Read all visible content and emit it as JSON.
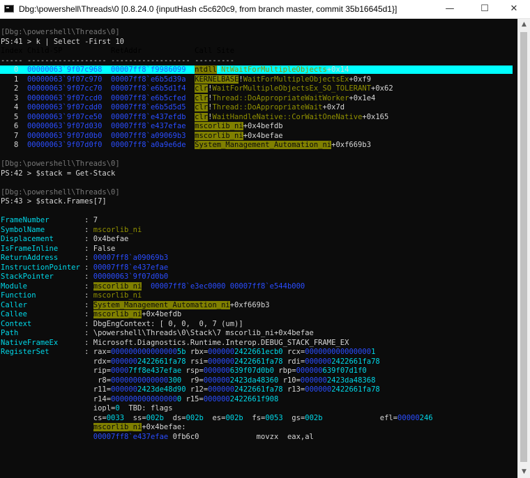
{
  "window": {
    "title": "Dbg:\\powershell\\Threads\\0 [0.8.24.0 {inputHash c5c620c9, from branch master, commit 35b16645d1}]",
    "minimize": "—",
    "maximize": "☐",
    "close": "✕"
  },
  "scrollbar": {
    "up": "▲",
    "down": "▼"
  },
  "console": {
    "prompt1_path": "[Dbg:\\powershell\\Threads\\0]",
    "prompt1_cmd": "PS:41 > k | Select -First 10",
    "hdr_index": "Index",
    "hdr_childsp": "Child-SP",
    "hdr_retaddr": "RetAddr",
    "hdr_callsite": "Call Site",
    "hdr_rule": "----- ------------------ ------------------ ---------",
    "frames": [
      {
        "idx": "0",
        "sp": "00000063`9f07c968",
        "ret": "00007ff8`f9986099",
        "mod": "ntdll",
        "sep": "!",
        "fn": "NtWaitForMultipleObjects",
        "off": "+0x14"
      },
      {
        "idx": "1",
        "sp": "00000063`9f07c970",
        "ret": "00007ff8`e6b5d39a",
        "mod": "KERNELBASE",
        "sep": "!",
        "fn": "WaitForMultipleObjectsEx",
        "off": "+0xf9"
      },
      {
        "idx": "2",
        "sp": "00000063`9f07cc70",
        "ret": "00007ff8`e6b5d1f4",
        "mod": "clr",
        "sep": "!",
        "fn": "WaitForMultipleObjectsEx_SO_TOLERANT",
        "off": "+0x62"
      },
      {
        "idx": "3",
        "sp": "00000063`9f07ccd0",
        "ret": "00007ff8`e6b5cfed",
        "mod": "clr",
        "sep": "!",
        "fn": "Thread::DoAppropriateWaitWorker",
        "off": "+0x1e4"
      },
      {
        "idx": "4",
        "sp": "00000063`9f07cdd0",
        "ret": "00007ff8`e6b5d5d5",
        "mod": "clr",
        "sep": "!",
        "fn": "Thread::DoAppropriateWait",
        "off": "+0x7d"
      },
      {
        "idx": "5",
        "sp": "00000063`9f07ce50",
        "ret": "00007ff8`e437efdb",
        "mod": "clr",
        "sep": "!",
        "fn": "WaitHandleNative::CorWaitOneNative",
        "off": "+0x165"
      },
      {
        "idx": "6",
        "sp": "00000063`9f07d030",
        "ret": "00007ff8`e437efae",
        "mod": "mscorlib_ni",
        "sep": "",
        "fn": "",
        "off": "+0x4befdb"
      },
      {
        "idx": "7",
        "sp": "00000063`9f07d0b0",
        "ret": "00007ff8`a09069b3",
        "mod": "mscorlib_ni",
        "sep": "",
        "fn": "",
        "off": "+0x4befae"
      },
      {
        "idx": "8",
        "sp": "00000063`9f07d0f0",
        "ret": "00007ff8`a0a9e6de",
        "mod": "System_Management_Automation_ni",
        "sep": "",
        "fn": "",
        "off": "+0xf669b3"
      }
    ],
    "prompt2_path": "[Dbg:\\powershell\\Threads\\0]",
    "prompt2_cmd": "PS:42 > $stack = Get-Stack",
    "prompt3_path": "[Dbg:\\powershell\\Threads\\0]",
    "prompt3_cmd": "PS:43 > $stack.Frames[7]",
    "props": {
      "FrameNumber": "7",
      "SymbolName": "mscorlib_ni",
      "Displacement": "0x4befae",
      "IsFrameInline": "False",
      "ReturnAddress": "00007ff8`a09069b3",
      "InstructionPointer": "00007ff8`e437efae",
      "StackPointer": "00000063`9f07d0b0",
      "Module_name": "mscorlib_ni",
      "Module_start": "00007ff8`e3ec0000",
      "Module_end": "00007ff8`e544b000",
      "Function": "mscorlib_ni",
      "Caller_mod": "System_Management_Automation_ni",
      "Caller_off": "+0xf669b3",
      "Callee_mod": "mscorlib_ni",
      "Callee_off": "+0x4befdb",
      "Context": "DbgEngContext: [ 0, 0,  0, 7 (um)]",
      "Path_text": "\\powershell\\Threads\\0\\Stack\\7 mscorlib_ni+0x4befae",
      "NativeFrameEx": "Microsoft.Diagnostics.Runtime.Interop.DEBUG_STACK_FRAME_EX"
    },
    "labels": {
      "FrameNumber": "FrameNumber",
      "SymbolName": "SymbolName",
      "Displacement": "Displacement",
      "IsFrameInline": "IsFrameInline",
      "ReturnAddress": "ReturnAddress",
      "InstructionPointer": "InstructionPointer",
      "StackPointer": "StackPointer",
      "Module": "Module",
      "Function": "Function",
      "Caller": "Caller",
      "Callee": "Callee",
      "Context": "Context",
      "Path": "Path",
      "NativeFrameEx": "NativeFrameEx",
      "RegisterSet": "RegisterSet"
    },
    "registers": [
      [
        {
          "n": "rax=",
          "z": "000000000000000",
          "v": "5b"
        },
        {
          "n": " rbx=",
          "z": "000000",
          "v": "2422661ecb0"
        },
        {
          "n": " rcx=",
          "z": "000000000000000",
          "v": "1"
        }
      ],
      [
        {
          "n": "rdx=",
          "z": "000000",
          "v": "2422661fa78"
        },
        {
          "n": " rsi=",
          "z": "000000",
          "v": "2422661fa78"
        },
        {
          "n": " rdi=",
          "z": "000000",
          "v": "2422661fa78"
        }
      ],
      [
        {
          "n": "rip=",
          "z": "0000",
          "v": "7ff8e437efae"
        },
        {
          "n": " rsp=",
          "z": "000000",
          "v": "639f07d0b0"
        },
        {
          "n": " rbp=",
          "z": "000000",
          "v": "639f07d1f0"
        }
      ],
      [
        {
          "n": " r8=",
          "z": "0000000000000",
          "v": "300"
        },
        {
          "n": "  r9=",
          "z": "000000",
          "v": "2423da48360"
        },
        {
          "n": " r10=",
          "z": "000000",
          "v": "2423da48368"
        }
      ],
      [
        {
          "n": "r11=",
          "z": "000000",
          "v": "2423de48d90"
        },
        {
          "n": " r12=",
          "z": "000000",
          "v": "2422661fa78"
        },
        {
          "n": " r13=",
          "z": "000000",
          "v": "2422661fa78"
        }
      ],
      [
        {
          "n": "r14=",
          "z": "000000000000000",
          "v": "0"
        },
        {
          "n": " r15=",
          "z": "000000",
          "v": "2422661f908"
        }
      ]
    ],
    "iopl_label": "iopl=",
    "iopl_val": "0",
    "tbd": "  TBD: flags",
    "segs": [
      {
        "n": "cs=",
        "v": "0033"
      },
      {
        "n": "  ss=",
        "v": "002b"
      },
      {
        "n": "  ds=",
        "v": "002b"
      },
      {
        "n": "  es=",
        "v": "002b"
      },
      {
        "n": "  fs=",
        "v": "0053"
      },
      {
        "n": "  gs=",
        "v": "002b"
      }
    ],
    "efl_label": "efl=",
    "efl_z": "00000",
    "efl_v": "246",
    "disasm_sym": "mscorlib_ni",
    "disasm_off": "+0x4befae:",
    "disasm_addr": "00007ff8`e437efae",
    "disasm_bytes": "0fb6c0",
    "disasm_op": "movzx",
    "disasm_args": "eax,al"
  }
}
